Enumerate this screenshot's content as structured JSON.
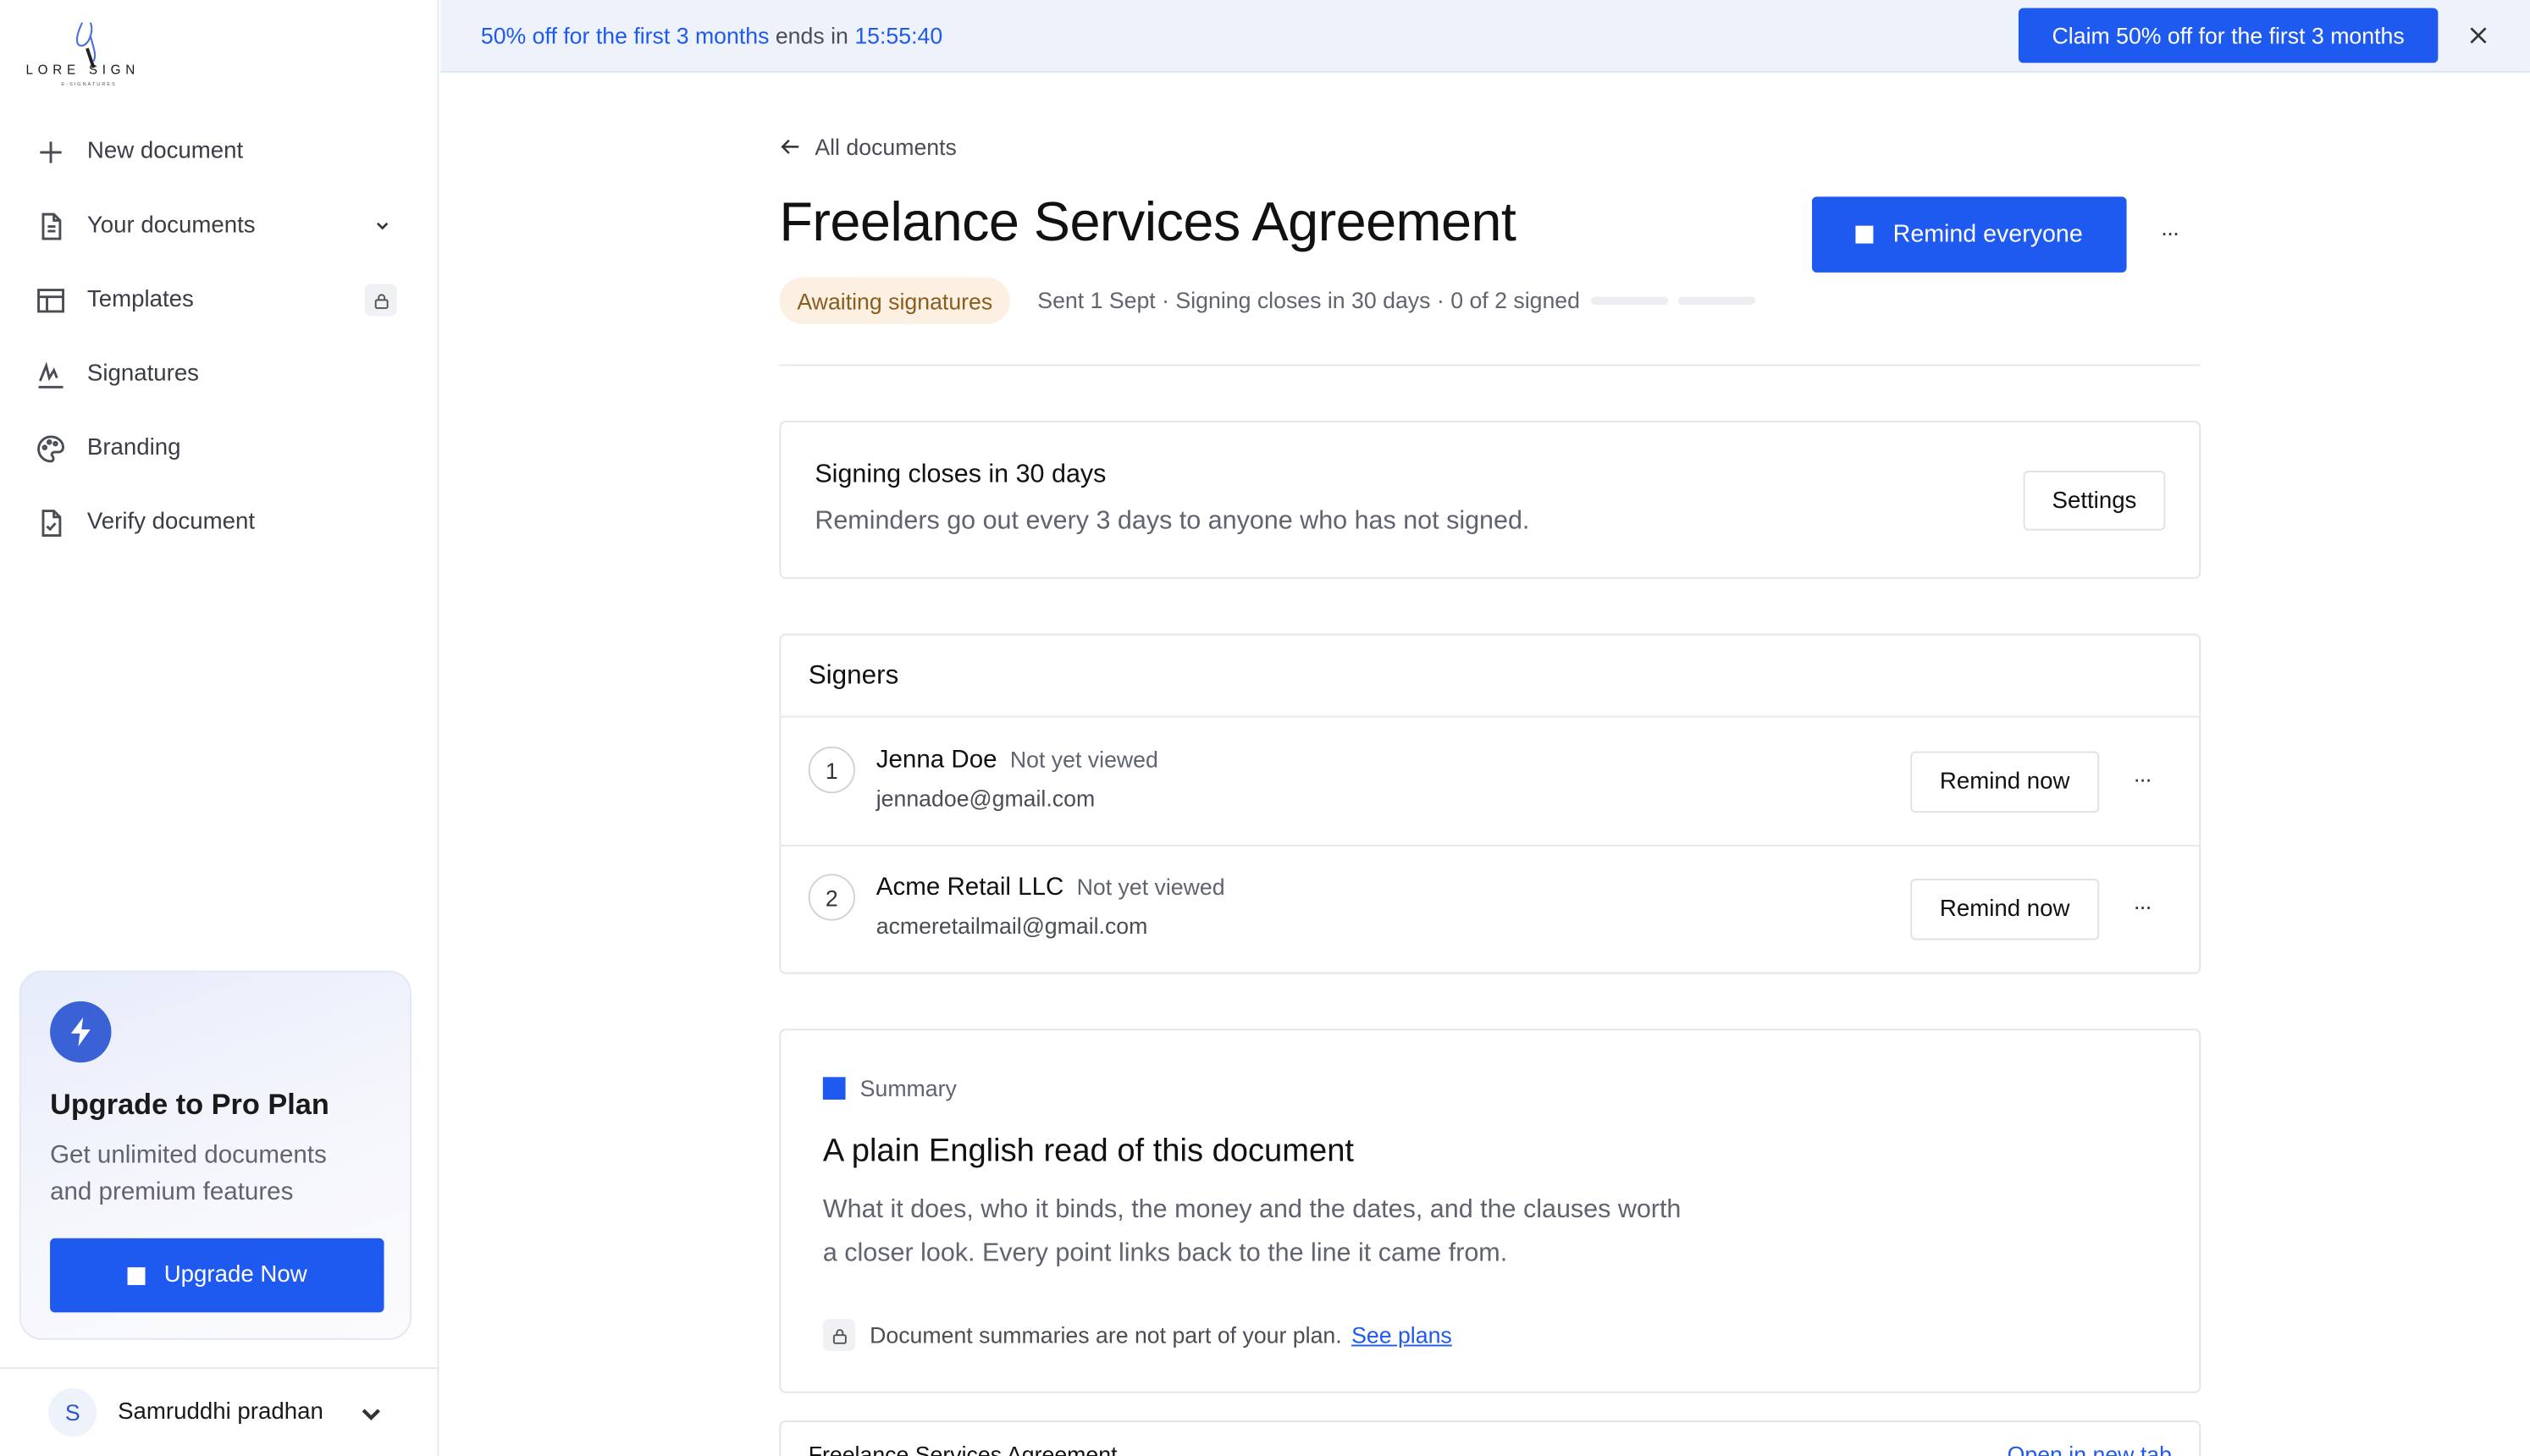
{
  "brand": {
    "logo_text": "LORE SIGN",
    "logo_sub": "E-SIGNATURES",
    "accent": "#1f5af0"
  },
  "sidebar": {
    "items": [
      {
        "label": "New document",
        "icon": "plus-icon"
      },
      {
        "label": "Your documents",
        "icon": "document-icon"
      },
      {
        "label": "Templates",
        "icon": "layout-icon"
      },
      {
        "label": "Signatures",
        "icon": "signature-icon"
      },
      {
        "label": "Branding",
        "icon": "palette-icon"
      },
      {
        "label": "Verify document",
        "icon": "verify-icon"
      }
    ],
    "upgrade": {
      "title": "Upgrade to Pro Plan",
      "description": "Get unlimited documents and premium features",
      "button": "Upgrade Now"
    },
    "user": {
      "initial": "S",
      "name": "Samruddhi pradhan"
    }
  },
  "promo": {
    "offer": "50% off for the first 3 months",
    "ends_in_text": "ends in",
    "countdown": "15:55:40",
    "button": "Claim 50% off for the first 3 months"
  },
  "document": {
    "back_label": "All documents",
    "title": "Freelance Services Agreement",
    "remind_all_button": "Remind everyone",
    "status": "Awaiting signatures",
    "meta": "Sent 1 Sept · Signing closes in 30 days · 0 of 2 signed",
    "signed_count": 0,
    "total_signers": 2
  },
  "closing": {
    "title": "Signing closes in 30 days",
    "subtitle": "Reminders go out every 3 days to anyone who has not signed.",
    "settings_button": "Settings"
  },
  "signers": {
    "heading": "Signers",
    "remind_label": "Remind now",
    "list": [
      {
        "number": "1",
        "name": "Jenna Doe",
        "status": "Not yet viewed",
        "email": "jennadoe@gmail.com"
      },
      {
        "number": "2",
        "name": "Acme Retail LLC",
        "status": "Not yet viewed",
        "email": "acmeretailmail@gmail.com"
      }
    ]
  },
  "summary": {
    "label": "Summary",
    "title": "A plain English read of this document",
    "description": "What it does, who it binds, the money and the dates, and the clauses worth a closer look. Every point links back to the line it came from.",
    "note": "Document summaries are not part of your plan.",
    "link": "See plans"
  },
  "preview": {
    "title": "Freelance Services Agreement",
    "link": "Open in new tab"
  }
}
